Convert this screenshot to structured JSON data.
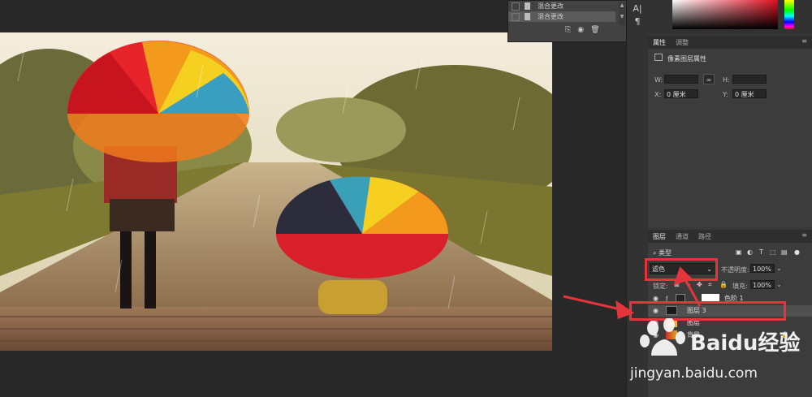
{
  "history": {
    "rows": [
      "混合更改",
      "混合更改"
    ]
  },
  "toolbar": {
    "text_tool_icon": "text-tool-icon",
    "paragraph_icon": "paragraph-icon",
    "text_label": "A|",
    "paragraph_label": "¶"
  },
  "properties": {
    "tab_active": "属性",
    "tab_other": "调整",
    "header": "像素图层属性",
    "w_label": "W:",
    "h_label": "H:",
    "x_label": "X:",
    "y_label": "Y:",
    "x_value": "0 厘米",
    "y_value": "0 厘米"
  },
  "layers": {
    "tabs": [
      "图层",
      "通道",
      "路径"
    ],
    "filter_label": "类型",
    "blend_mode": "滤色",
    "opacity_label": "不透明度:",
    "opacity_value": "100%",
    "lock_label": "锁定:",
    "fill_label": "填充:",
    "fill_value": "100%",
    "items": [
      {
        "name": "色阶 1"
      },
      {
        "name": "图层 3"
      },
      {
        "name": "图层"
      },
      {
        "name": "背景"
      }
    ]
  },
  "watermark": {
    "brand": "Baidu经验",
    "url": "jingyan.baidu.com"
  },
  "colors": {
    "accent_red": "#e4353a",
    "panel_bg": "#383838",
    "canvas_bg": "#282828"
  }
}
